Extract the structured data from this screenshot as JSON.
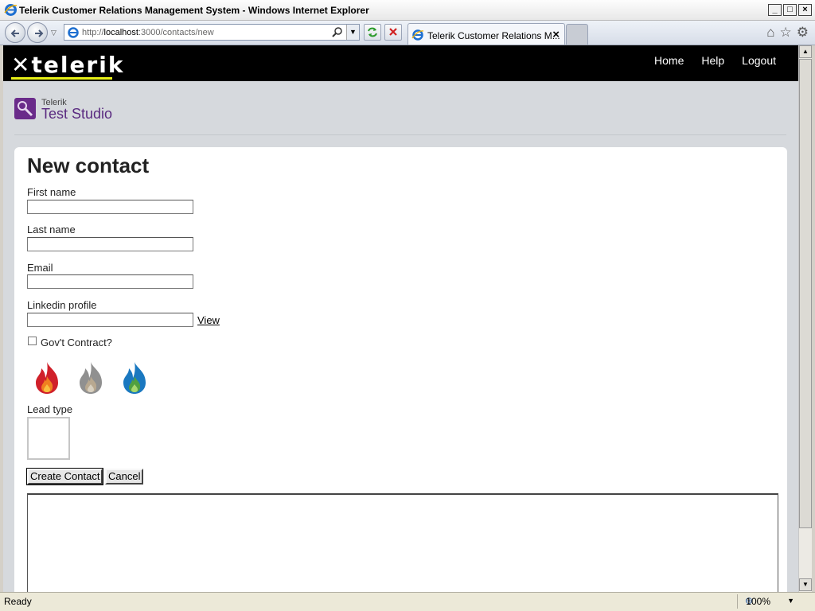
{
  "window": {
    "title": "Telerik Customer Relations Management System - Windows Internet Explorer",
    "minimize": "_",
    "maximize": "□",
    "close": "×"
  },
  "browser": {
    "url_prefix": "http://",
    "url_host": "localhost",
    "url_rest": ":3000/contacts/new",
    "tab_title": "Telerik Customer Relations M...",
    "tab_close": "×",
    "status": "Ready",
    "zoom": "100%"
  },
  "site": {
    "logo_text": "telerik",
    "nav": [
      "Home",
      "Help",
      "Logout"
    ],
    "brand_small": "Telerik",
    "brand_big": "Test Studio"
  },
  "form": {
    "title": "New contact",
    "first_name_label": "First name",
    "first_name_value": "",
    "last_name_label": "Last name",
    "last_name_value": "",
    "email_label": "Email",
    "email_value": "",
    "linkedin_label": "Linkedin profile",
    "linkedin_value": "",
    "view_link": "View",
    "govt_label": "Gov't Contract?",
    "govt_checked": false,
    "lead_type_label": "Lead type",
    "lead_icons": [
      {
        "name": "hot-lead-icon",
        "color": "#d0202a"
      },
      {
        "name": "cold-lead-icon",
        "color": "#909090"
      },
      {
        "name": "warm-lead-icon",
        "color": "#1a78c0"
      }
    ],
    "create_button": "Create Contact",
    "cancel_button": "Cancel"
  },
  "colors": {
    "header_bg": "#000000",
    "logo_underline": "#e6ef16",
    "brand_purple": "#5a2a80"
  }
}
